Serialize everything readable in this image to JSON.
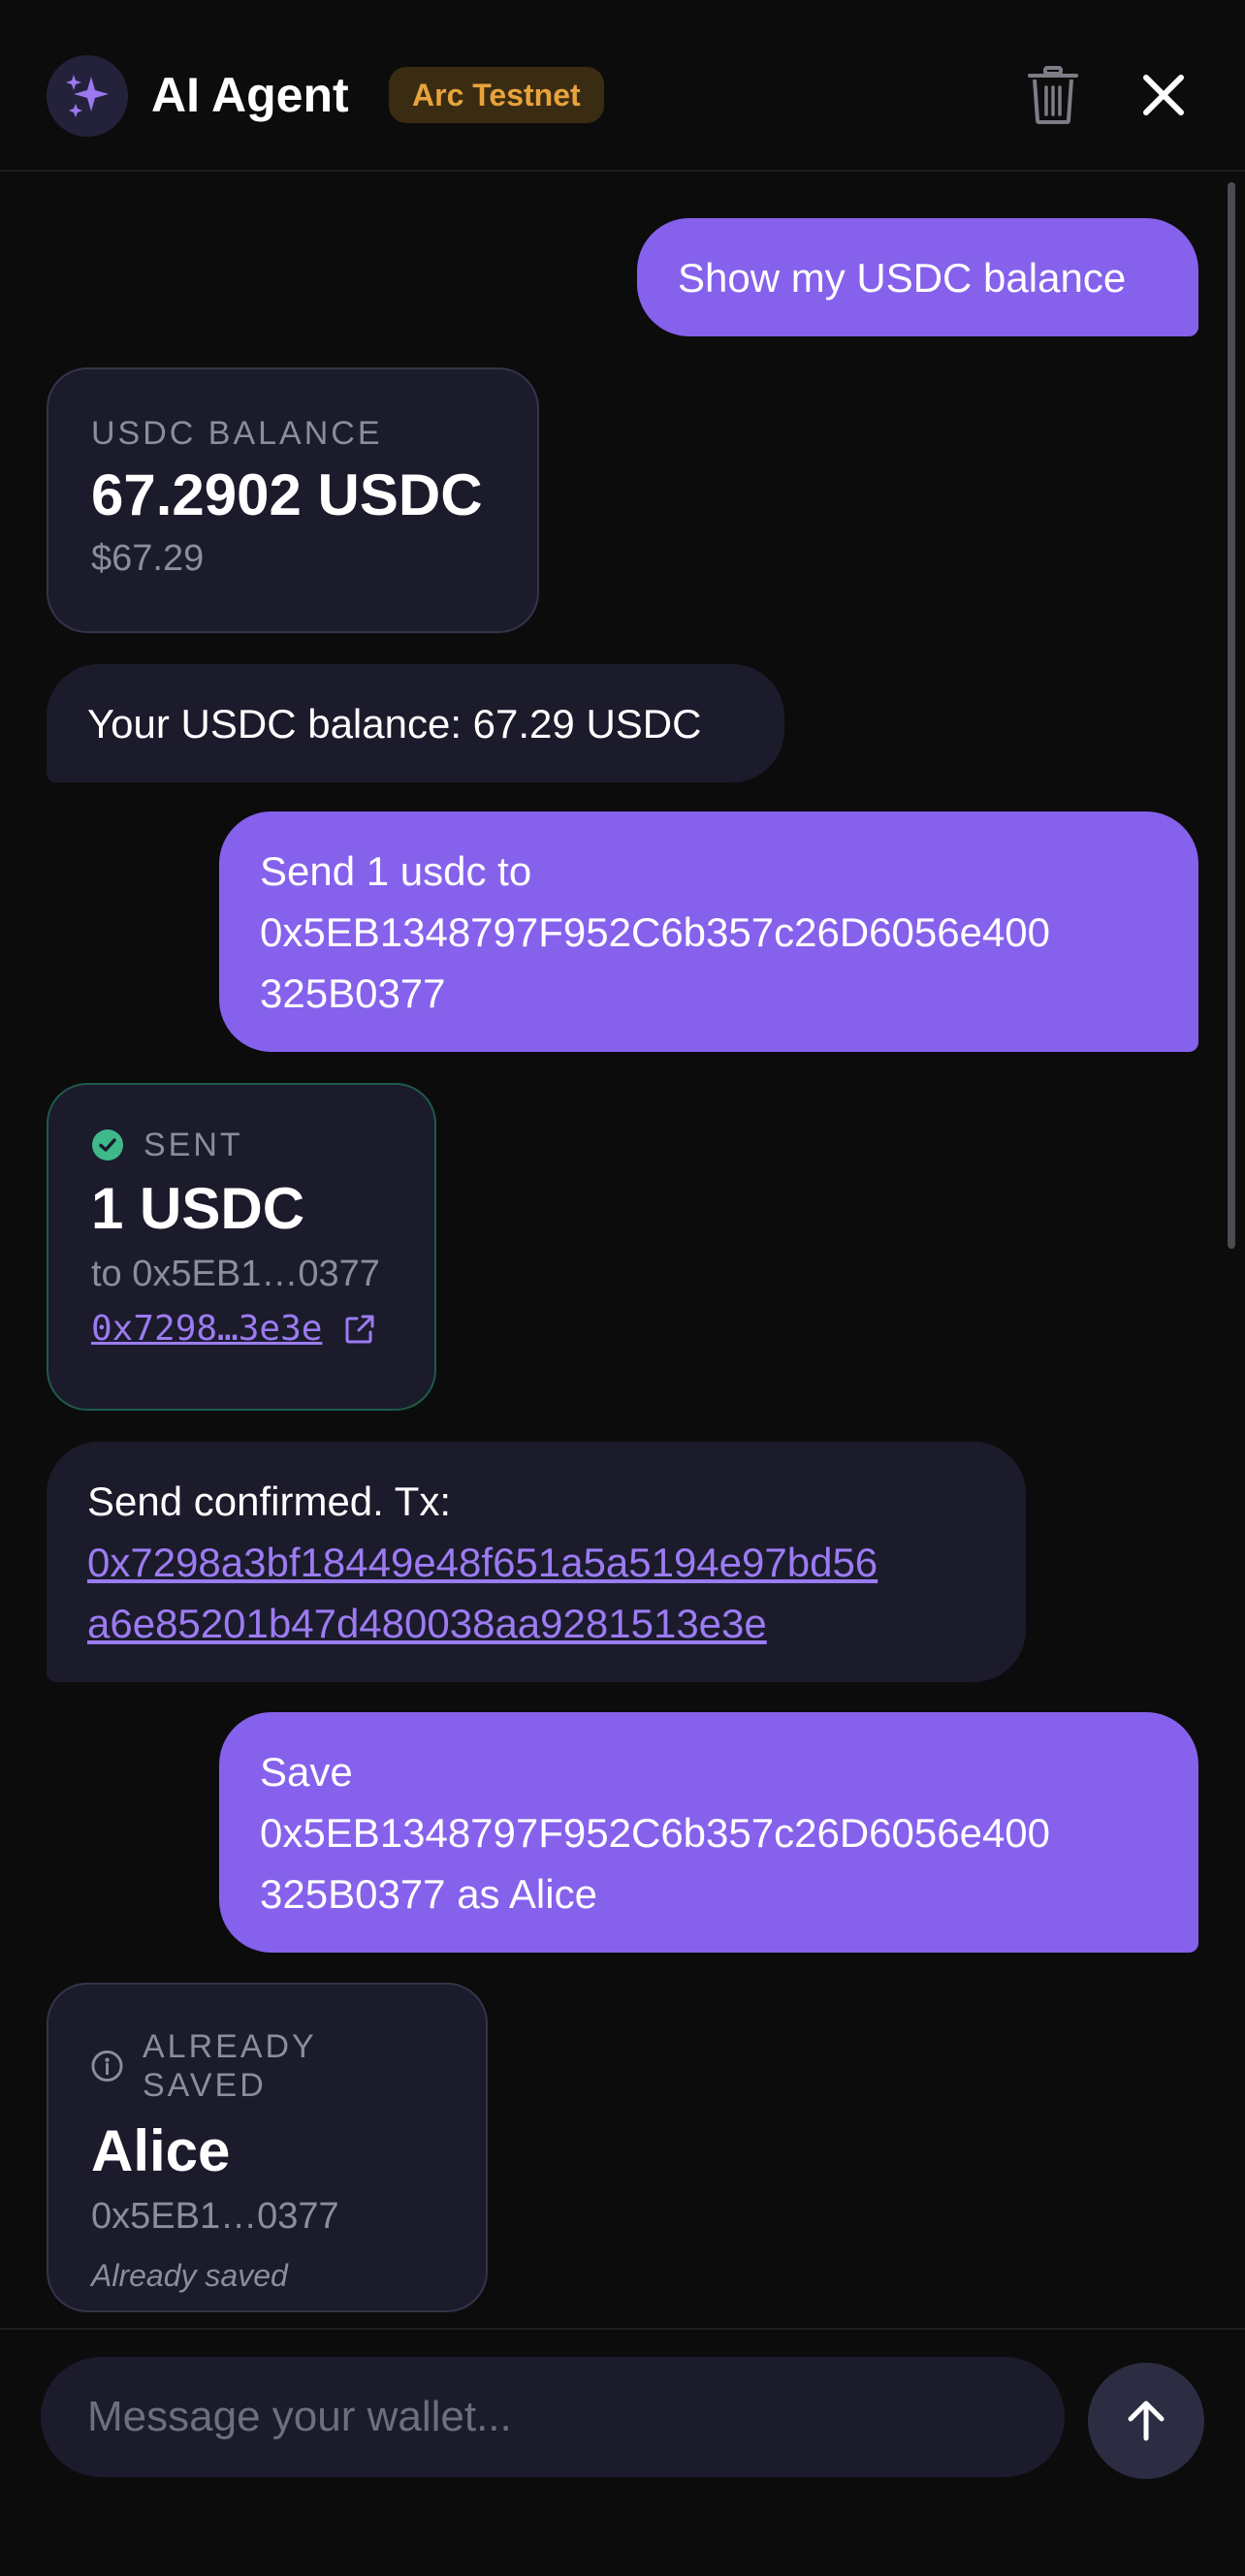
{
  "header": {
    "title": "AI Agent",
    "network_badge": "Arc Testnet",
    "icons": {
      "logo": "sparkles-icon",
      "delete": "trash-icon",
      "close": "close-icon"
    }
  },
  "messages": {
    "m1": {
      "text": "Show my USDC balance"
    },
    "balance_card": {
      "label": "USDC BALANCE",
      "amount": "67.2902 USDC",
      "usd_value": "$67.29"
    },
    "m2": {
      "text": "Your USDC balance: 67.29 USDC"
    },
    "m3": {
      "line1": "Send 1 usdc to",
      "line2": "0x5EB1348797F952C6b357c26D6056e400",
      "line3": "325B0377"
    },
    "sent_card": {
      "status": "SENT",
      "amount": "1 USDC",
      "recipient": "to 0x5EB1…0377",
      "tx_short": "0x7298…3e3e"
    },
    "m4": {
      "prefix": "Send confirmed. Tx:",
      "tx_line1": "0x7298a3bf18449e48f651a5a5194e97bd56",
      "tx_line2": "a6e85201b47d480038aa9281513e3e"
    },
    "m5": {
      "line1": "Save",
      "line2": "0x5EB1348797F952C6b357c26D6056e400",
      "line3": "325B0377 as Alice"
    },
    "saved_card": {
      "status": "ALREADY SAVED",
      "name": "Alice",
      "address": "0x5EB1…0377",
      "note": "Already saved"
    }
  },
  "composer": {
    "placeholder": "Message your wallet...",
    "send_icon": "arrow-up-icon"
  },
  "colors": {
    "background": "#0c0c0d",
    "user_bubble": "#8661ec",
    "bot_bubble": "#1b1b2c",
    "link": "#9c7bf2",
    "success": "#3fb98a",
    "badge_text": "#e8a33c",
    "badge_bg": "#3a2c12"
  }
}
